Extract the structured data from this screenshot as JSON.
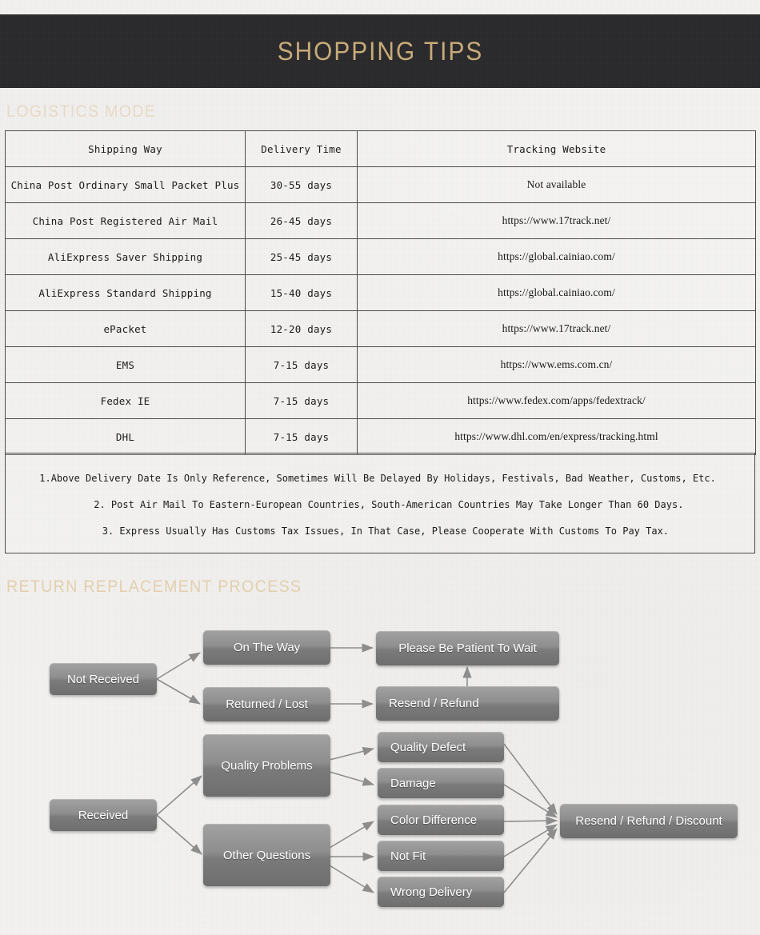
{
  "banner": {
    "title": "SHOPPING TIPS",
    "bg_color": "#2b2b2d",
    "title_color": "#c8ab79"
  },
  "sections": {
    "logistics_heading": "LOGISTICS MODE",
    "return_heading": "RETURN REPLACEMENT PROCESS"
  },
  "logistics_table": {
    "columns": [
      "Shipping Way",
      "Delivery Time",
      "Tracking Website"
    ],
    "rows": [
      {
        "way": "China Post Ordinary Small Packet Plus",
        "time": "30-55 days",
        "url": "Not available"
      },
      {
        "way": "China Post Registered Air Mail",
        "time": "26-45 days",
        "url": "https://www.17track.net/"
      },
      {
        "way": "AliExpress Saver Shipping",
        "time": "25-45 days",
        "url": "https://global.cainiao.com/"
      },
      {
        "way": "AliExpress Standard Shipping",
        "time": "15-40 days",
        "url": "https://global.cainiao.com/"
      },
      {
        "way": "ePacket",
        "time": "12-20 days",
        "url": "https://www.17track.net/"
      },
      {
        "way": "EMS",
        "time": "7-15 days",
        "url": "https://www.ems.com.cn/"
      },
      {
        "way": "Fedex IE",
        "time": "7-15 days",
        "url": "https://www.fedex.com/apps/fedextrack/"
      },
      {
        "way": "DHL",
        "time": "7-15 days",
        "url": "https://www.dhl.com/en/express/tracking.html"
      }
    ]
  },
  "notes": [
    "1.Above Delivery Date Is Only Reference, Sometimes Will Be Delayed By Holidays, Festivals, Bad Weather, Customs, Etc.",
    "2. Post Air Mail To Eastern-European Countries, South-American Countries May Take Longer Than 60 Days.",
    "3. Express Usually Has Customs Tax Issues, In That Case, Please Cooperate With Customs To Pay Tax."
  ],
  "flowchart": {
    "node_color_top": "#a2a2a2",
    "node_color_bottom": "#6e6e6e",
    "arrow_color": "#8a8a8a",
    "nodes": {
      "not_received": "Not Received",
      "on_the_way": "On The Way",
      "returned_lost": "Returned / Lost",
      "please_wait": "Please Be Patient To Wait",
      "resend_refund": "Resend / Refund",
      "received": "Received",
      "quality_problems": "Quality Problems",
      "other_questions": "Other Questions",
      "quality_defect": "Quality Defect",
      "damage": "Damage",
      "color_difference": "Color Difference",
      "not_fit": "Not Fit",
      "wrong_delivery": "Wrong Delivery",
      "resend_refund_discount": "Resend / Refund / Discount"
    }
  }
}
